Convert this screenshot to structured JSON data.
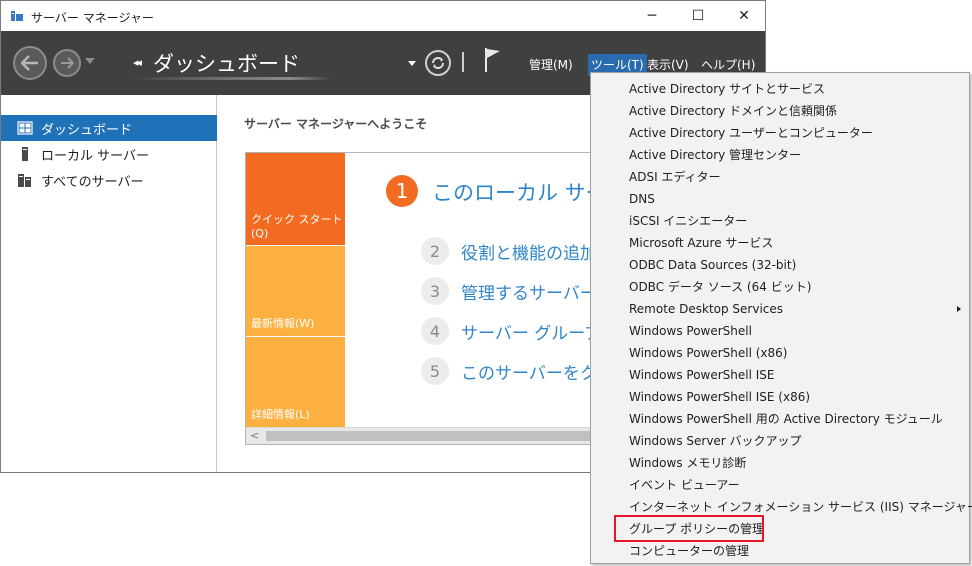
{
  "window": {
    "title": "サーバー マネージャー",
    "controls": {
      "minimize": "─",
      "maximize": "☐",
      "close": "✕"
    }
  },
  "toolbar": {
    "breadcrumb_arrows": "◂◂",
    "breadcrumb": "ダッシュボード",
    "menu": [
      {
        "label": "管理(M)"
      },
      {
        "label": "ツール(T)"
      },
      {
        "label": "表示(V)"
      },
      {
        "label": "ヘルプ(H)"
      }
    ]
  },
  "sidebar": {
    "items": [
      {
        "label": "ダッシュボード",
        "icon": "dashboard-icon",
        "active": true
      },
      {
        "label": "ローカル サーバー",
        "icon": "server-icon",
        "active": false
      },
      {
        "label": "すべてのサーバー",
        "icon": "servers-icon",
        "active": false
      }
    ]
  },
  "main": {
    "welcome": "サーバー マネージャーへようこそ",
    "tiles": [
      {
        "label": "クイック スタート(Q)"
      },
      {
        "label": "最新情報(W)"
      },
      {
        "label": "詳細情報(L)"
      }
    ],
    "steps": [
      {
        "num": "1",
        "text": "このローカル サーバー"
      },
      {
        "num": "2",
        "text": "役割と機能の追加"
      },
      {
        "num": "3",
        "text": "管理するサーバーの追加"
      },
      {
        "num": "4",
        "text": "サーバー グループの作成"
      },
      {
        "num": "5",
        "text": "このサーバーをクラウド サービスに接続する"
      }
    ],
    "scroll_left": "<"
  },
  "tools_menu": {
    "items": [
      "Active Directory サイトとサービス",
      "Active Directory ドメインと信頼関係",
      "Active Directory ユーザーとコンピューター",
      "Active Directory 管理センター",
      "ADSI エディター",
      "DNS",
      "iSCSI イニシエーター",
      "Microsoft Azure サービス",
      "ODBC Data Sources (32-bit)",
      "ODBC データ ソース (64 ビット)",
      "Remote Desktop Services",
      "Windows PowerShell",
      "Windows PowerShell (x86)",
      "Windows PowerShell ISE",
      "Windows PowerShell ISE (x86)",
      "Windows PowerShell 用の Active Directory モジュール",
      "Windows Server バックアップ",
      "Windows メモリ診断",
      "イベント ビューアー",
      "インターネット インフォメーション サービス (IIS) マネージャー",
      "グループ ポリシーの管理",
      "コンピューターの管理"
    ],
    "submenu_item": "Remote Desktop Services",
    "highlighted_item": "グループ ポリシーの管理"
  },
  "colors": {
    "toolbar": "#404040",
    "active_blue": "#1f72b8",
    "orange": "#f26b21",
    "amber": "#fbb040",
    "link_blue": "#2f86c8",
    "highlight_red": "#e8142a"
  }
}
